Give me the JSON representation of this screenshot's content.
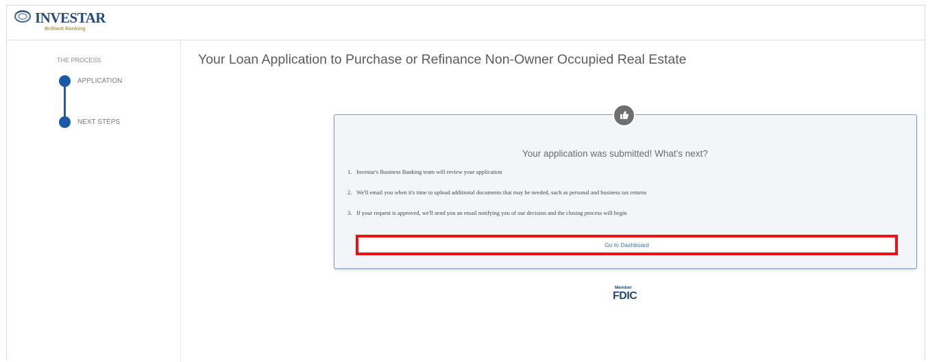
{
  "brand": {
    "name": "INVESTAR",
    "tagline": "Brilliant Banking",
    "color": "#234a7a"
  },
  "sidebar": {
    "process_label": "THE PROCESS",
    "steps": [
      {
        "label": "APPLICATION",
        "state": "complete"
      },
      {
        "label": "NEXT STEPS",
        "state": "current"
      }
    ]
  },
  "main": {
    "title": "Your Loan Application to Purchase or Refinance Non-Owner Occupied Real Estate",
    "card": {
      "icon": "thumbs-up-icon",
      "heading": "Your application was submitted! What's next?",
      "items": [
        {
          "number": "1.",
          "text": "Investar's Business Banking team will review your application"
        },
        {
          "number": "2.",
          "text": "We'll email you when it's time to upload additional documents that may be needed, such as personal and business tax returns"
        },
        {
          "number": "3.",
          "text": "If your request is approved, we'll send you an email notifying you of our decision and the closing process will begin"
        }
      ],
      "button_label": "Go to Dashboard",
      "highlight_color": "#ee1111"
    }
  },
  "footer": {
    "fdic_member": "Member",
    "fdic": "FDIC"
  },
  "colors": {
    "step_dot": "#1a5aa6",
    "link": "#3a6fb0"
  }
}
